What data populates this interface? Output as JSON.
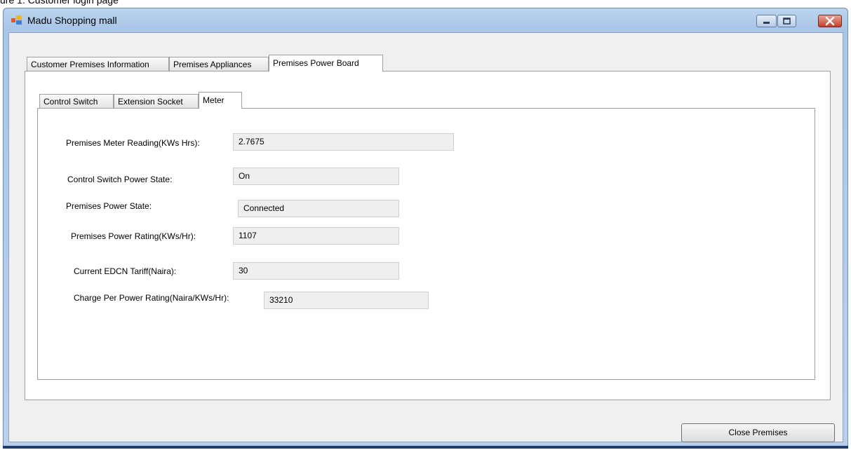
{
  "caption": "ure 1: Customer login page",
  "window": {
    "title": "Madu Shopping mall",
    "icon": "app-windows-icon",
    "controls": {
      "minimize": "minimize-icon",
      "maximize": "maximize-icon",
      "close": "close-icon"
    }
  },
  "outer_tabs": [
    {
      "label": "Customer Premises Information"
    },
    {
      "label": "Premises Appliances"
    },
    {
      "label": "Premises Power Board"
    }
  ],
  "outer_tabs_selected": "Premises Power Board",
  "inner_tabs": [
    {
      "label": "Control Switch"
    },
    {
      "label": "Extension Socket"
    },
    {
      "label": "Meter"
    }
  ],
  "inner_tabs_selected": "Meter",
  "meter": {
    "reading_label": "Premises Meter Reading(KWs Hrs):",
    "reading_value": "2.7675",
    "switch_state_label": "Control Switch Power State:",
    "switch_state_value": "On",
    "power_state_label": "Premises Power State:",
    "power_state_value": "Connected",
    "power_rating_label": "Premises Power Rating(KWs/Hr):",
    "power_rating_value": "1107",
    "tariff_label": "Current EDCN Tariff(Naira):",
    "tariff_value": "30",
    "charge_label": "Charge Per Power Rating(Naira/KWs/Hr):",
    "charge_value": "33210"
  },
  "buttons": {
    "close_premises": "Close Premises"
  },
  "colors": {
    "title_bar": "#b9d1ea",
    "client_bg": "#f0f0f0",
    "close_button": "#c2412b"
  }
}
